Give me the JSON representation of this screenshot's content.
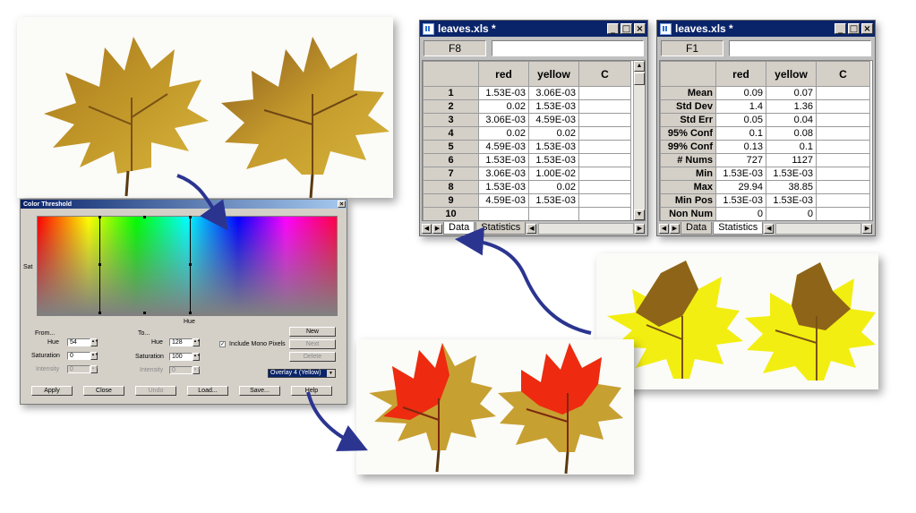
{
  "spreadsheet_data": {
    "title": "leaves.xls *",
    "cell_ref": "F8",
    "columns": [
      "red",
      "yellow",
      "C"
    ],
    "rows": [
      {
        "n": "1",
        "red": "1.53E-03",
        "yellow": "3.06E-03"
      },
      {
        "n": "2",
        "red": "0.02",
        "yellow": "1.53E-03"
      },
      {
        "n": "3",
        "red": "3.06E-03",
        "yellow": "4.59E-03"
      },
      {
        "n": "4",
        "red": "0.02",
        "yellow": "0.02"
      },
      {
        "n": "5",
        "red": "4.59E-03",
        "yellow": "1.53E-03"
      },
      {
        "n": "6",
        "red": "1.53E-03",
        "yellow": "1.53E-03"
      },
      {
        "n": "7",
        "red": "3.06E-03",
        "yellow": "1.00E-02"
      },
      {
        "n": "8",
        "red": "1.53E-03",
        "yellow": "0.02"
      },
      {
        "n": "9",
        "red": "4.59E-03",
        "yellow": "1.53E-03"
      },
      {
        "n": "10",
        "red": "",
        "yellow": ""
      }
    ],
    "tabs": [
      "Data",
      "Statistics"
    ],
    "active_tab": "Data"
  },
  "spreadsheet_stats": {
    "title": "leaves.xls *",
    "cell_ref": "F1",
    "columns": [
      "red",
      "yellow",
      "C"
    ],
    "rows": [
      {
        "n": "Mean",
        "red": "0.09",
        "yellow": "0.07"
      },
      {
        "n": "Std Dev",
        "red": "1.4",
        "yellow": "1.36"
      },
      {
        "n": "Std Err",
        "red": "0.05",
        "yellow": "0.04"
      },
      {
        "n": "95% Conf",
        "red": "0.1",
        "yellow": "0.08"
      },
      {
        "n": "99% Conf",
        "red": "0.13",
        "yellow": "0.1"
      },
      {
        "n": "# Nums",
        "red": "727",
        "yellow": "1127"
      },
      {
        "n": "Min",
        "red": "1.53E-03",
        "yellow": "1.53E-03"
      },
      {
        "n": "Max",
        "red": "29.94",
        "yellow": "38.85"
      },
      {
        "n": "Min Pos",
        "red": "1.53E-03",
        "yellow": "1.53E-03"
      },
      {
        "n": "Non Num",
        "red": "0",
        "yellow": "0"
      }
    ],
    "tabs": [
      "Data",
      "Statistics"
    ],
    "active_tab": "Statistics"
  },
  "color_threshold": {
    "title": "Color Threshold",
    "sat_label": "Sat",
    "hue_label": "Hue",
    "from_label": "From...",
    "to_label": "To...",
    "from_hue": "54",
    "from_saturation": "0",
    "from_intensity": "0",
    "to_hue": "128",
    "to_saturation": "100",
    "to_intensity": "0",
    "field_hue": "Hue",
    "field_saturation": "Saturation",
    "field_intensity": "Intensity",
    "include_mono": "Include Mono Pixels",
    "include_mono_checked": true,
    "btn_new": "New",
    "btn_next": "Next",
    "btn_delete": "Delete",
    "overlay": "Overlay 4 (Yellow)",
    "btn_apply": "Apply",
    "btn_close": "Close",
    "btn_undo": "Undo",
    "btn_load": "Load...",
    "btn_save": "Save...",
    "btn_help": "Help"
  },
  "colors": {
    "leaf_brown": "#b8861f",
    "leaf_gold": "#c7a032",
    "overlay_yellow": "#f2ee12",
    "overlay_red": "#ee2a10",
    "arrow_blue": "#2b3590"
  }
}
